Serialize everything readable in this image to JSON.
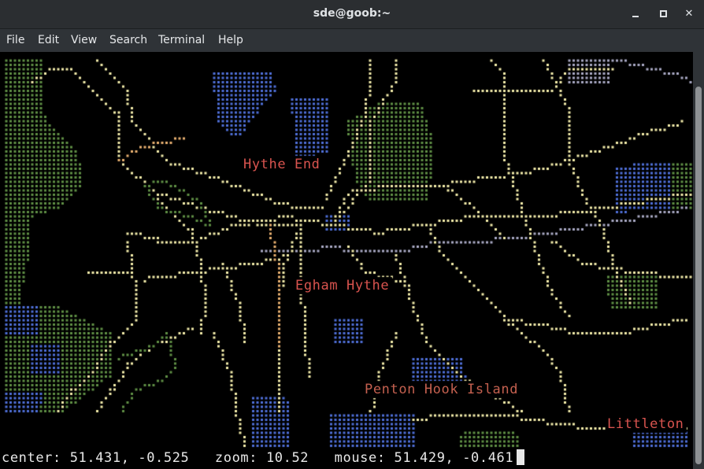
{
  "window": {
    "title": "sde@goob:~",
    "controls": {
      "minimize": "minimize",
      "maximize": "maximize",
      "close": "close"
    }
  },
  "menu": {
    "items": [
      {
        "label": "File"
      },
      {
        "label": "Edit"
      },
      {
        "label": "View"
      },
      {
        "label": "Search"
      },
      {
        "label": "Terminal"
      },
      {
        "label": "Help"
      }
    ]
  },
  "map": {
    "labels": [
      {
        "text": "Hythe End"
      },
      {
        "text": "Egham Hythe"
      },
      {
        "text": "Penton Hook Island"
      },
      {
        "text": "Littleton"
      }
    ],
    "colors": {
      "label": "#d9544f",
      "label_muted": "#c4604f",
      "road_major": "#f2ebaa",
      "road_minor": "#a9a9c4",
      "water": "#4f6fd8",
      "park": "#5f8f45",
      "road_orange": "#e8b070"
    }
  },
  "status": {
    "center_label": "center:",
    "center_value": "51.431, -0.525",
    "zoom_label": "zoom:",
    "zoom_value": "10.52",
    "mouse_label": "mouse:",
    "mouse_value": "51.429, -0.461"
  },
  "scrollbar": {
    "position_fraction": 1.0
  }
}
